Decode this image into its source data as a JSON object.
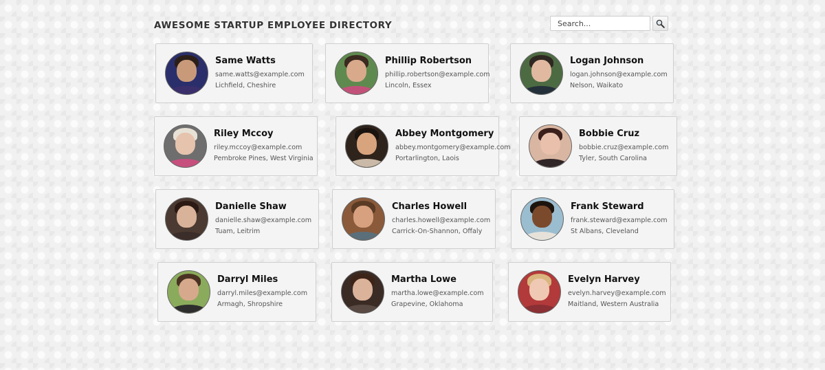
{
  "header": {
    "title": "AWESOME STARTUP EMPLOYEE DIRECTORY",
    "search_placeholder": "Search...",
    "search_icon": "magnifying-glass-icon"
  },
  "employees": [
    {
      "name": "Same Watts",
      "email": "same.watts@example.com",
      "location": "Lichfield, Cheshire",
      "bg": "#2a2f6b",
      "skin": "#c99a7a",
      "hair": "#2b1f18",
      "shirt": "#3a2f6b"
    },
    {
      "name": "Phillip Robertson",
      "email": "phillip.robertson@example.com",
      "location": "Lincoln, Essex",
      "bg": "#5f8a4f",
      "skin": "#d9a98c",
      "hair": "#3a2a20",
      "shirt": "#c2517a"
    },
    {
      "name": "Logan Johnson",
      "email": "logan.johnson@example.com",
      "location": "Nelson, Waikato",
      "bg": "#4d6b43",
      "skin": "#e0b9a0",
      "hair": "#2f2722",
      "shirt": "#23303a"
    },
    {
      "name": "Riley Mccoy",
      "email": "riley.mccoy@example.com",
      "location": "Pembroke Pines, West Virginia",
      "bg": "#6e6e6e",
      "skin": "#e6c3ad",
      "hair": "#e8e2d6",
      "shirt": "#c74f7d"
    },
    {
      "name": "Abbey Montgomery",
      "email": "abbey.montgomery@example.com",
      "location": "Portarlington, Laois",
      "bg": "#2e241c",
      "skin": "#d8a47d",
      "hair": "#1b130e",
      "shirt": "#c9b9a6"
    },
    {
      "name": "Bobbie Cruz",
      "email": "bobbie.cruz@example.com",
      "location": "Tyler, South Carolina",
      "bg": "#d9b6a2",
      "skin": "#e8c0ac",
      "hair": "#3b1f1b",
      "shirt": "#2f2426"
    },
    {
      "name": "Danielle Shaw",
      "email": "danielle.shaw@example.com",
      "location": "Tuam, Leitrim",
      "bg": "#4b3a31",
      "skin": "#d9b29a",
      "hair": "#2a1a13",
      "shirt": "#3a2d2a"
    },
    {
      "name": "Charles Howell",
      "email": "charles.howell@example.com",
      "location": "Carrick-On-Shannon, Offaly",
      "bg": "#8a5a3a",
      "skin": "#d7a07e",
      "hair": "#5a3b24",
      "shirt": "#5b6f7a"
    },
    {
      "name": "Frank Steward",
      "email": "frank.steward@example.com",
      "location": "St Albans, Cleveland",
      "bg": "#9bbdd0",
      "skin": "#7b4a2d",
      "hair": "#1d130d",
      "shirt": "#e6e2da"
    },
    {
      "name": "Darryl Miles",
      "email": "darryl.miles@example.com",
      "location": "Armagh, Shropshire",
      "bg": "#8bab5c",
      "skin": "#d6a98c",
      "hair": "#4a3223",
      "shirt": "#2d2d2d"
    },
    {
      "name": "Martha Lowe",
      "email": "martha.lowe@example.com",
      "location": "Grapevine, Oklahoma",
      "bg": "#3a2b25",
      "skin": "#dbb29a",
      "hair": "#3d2418",
      "shirt": "#5a4a44"
    },
    {
      "name": "Evelyn Harvey",
      "email": "evelyn.harvey@example.com",
      "location": "Maitland, Western Australia",
      "bg": "#b33a3a",
      "skin": "#efc9b3",
      "hair": "#d9b67d",
      "shirt": "#8a2f33"
    }
  ]
}
